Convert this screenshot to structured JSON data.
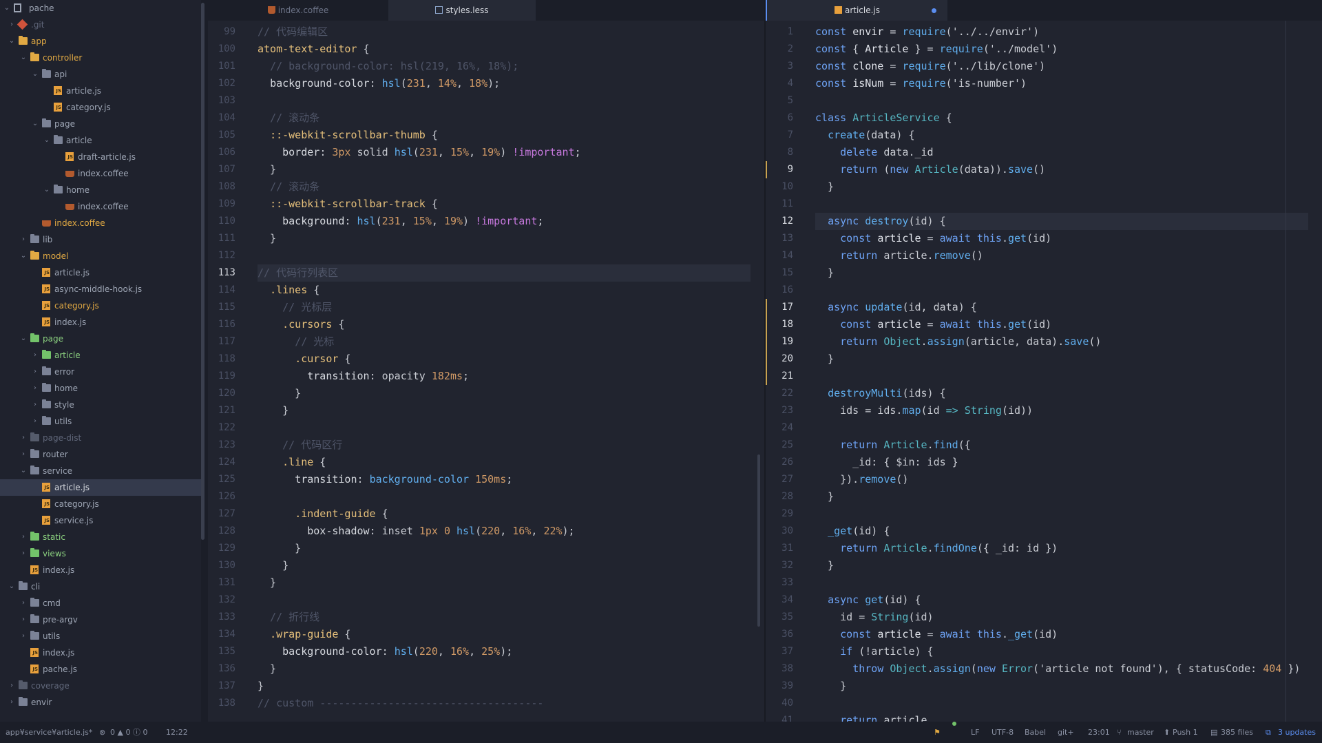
{
  "tree": {
    "root": "pache",
    "items": [
      {
        "label": ".git",
        "depth": 1,
        "kind": "git",
        "chev": "right",
        "color": "dim"
      },
      {
        "label": "app",
        "depth": 1,
        "kind": "folder-yellow",
        "chev": "down",
        "color": "yellow"
      },
      {
        "label": "controller",
        "depth": 2,
        "kind": "folder-yellow",
        "chev": "down",
        "color": "yellow"
      },
      {
        "label": "api",
        "depth": 3,
        "kind": "folder",
        "chev": "down",
        "color": "norm"
      },
      {
        "label": "article.js",
        "depth": 4,
        "kind": "js",
        "chev": "",
        "color": "norm"
      },
      {
        "label": "category.js",
        "depth": 4,
        "kind": "js",
        "chev": "",
        "color": "norm"
      },
      {
        "label": "page",
        "depth": 3,
        "kind": "folder",
        "chev": "down",
        "color": "norm"
      },
      {
        "label": "article",
        "depth": 4,
        "kind": "folder",
        "chev": "down",
        "color": "norm"
      },
      {
        "label": "draft-article.js",
        "depth": 5,
        "kind": "js",
        "chev": "",
        "color": "norm"
      },
      {
        "label": "index.coffee",
        "depth": 5,
        "kind": "coffee",
        "chev": "",
        "color": "norm"
      },
      {
        "label": "home",
        "depth": 4,
        "kind": "folder",
        "chev": "down",
        "color": "norm"
      },
      {
        "label": "index.coffee",
        "depth": 5,
        "kind": "coffee",
        "chev": "",
        "color": "norm"
      },
      {
        "label": "index.coffee",
        "depth": 3,
        "kind": "coffee",
        "chev": "",
        "color": "yellow"
      },
      {
        "label": "lib",
        "depth": 2,
        "kind": "folder",
        "chev": "right",
        "color": "norm"
      },
      {
        "label": "model",
        "depth": 2,
        "kind": "folder-yellow",
        "chev": "down",
        "color": "yellow"
      },
      {
        "label": "article.js",
        "depth": 3,
        "kind": "js",
        "chev": "",
        "color": "norm"
      },
      {
        "label": "async-middle-hook.js",
        "depth": 3,
        "kind": "js",
        "chev": "",
        "color": "norm"
      },
      {
        "label": "category.js",
        "depth": 3,
        "kind": "js",
        "chev": "",
        "color": "yellow"
      },
      {
        "label": "index.js",
        "depth": 3,
        "kind": "js",
        "chev": "",
        "color": "norm"
      },
      {
        "label": "page",
        "depth": 2,
        "kind": "folder-green",
        "chev": "down",
        "color": "green"
      },
      {
        "label": "article",
        "depth": 3,
        "kind": "folder-green",
        "chev": "right",
        "color": "green"
      },
      {
        "label": "error",
        "depth": 3,
        "kind": "folder",
        "chev": "right",
        "color": "norm"
      },
      {
        "label": "home",
        "depth": 3,
        "kind": "folder",
        "chev": "right",
        "color": "norm"
      },
      {
        "label": "style",
        "depth": 3,
        "kind": "folder",
        "chev": "right",
        "color": "norm"
      },
      {
        "label": "utils",
        "depth": 3,
        "kind": "folder",
        "chev": "right",
        "color": "norm"
      },
      {
        "label": "page-dist",
        "depth": 2,
        "kind": "folder-dim",
        "chev": "right",
        "color": "dim"
      },
      {
        "label": "router",
        "depth": 2,
        "kind": "folder",
        "chev": "right",
        "color": "norm"
      },
      {
        "label": "service",
        "depth": 2,
        "kind": "folder",
        "chev": "down",
        "color": "norm"
      },
      {
        "label": "article.js",
        "depth": 3,
        "kind": "js",
        "chev": "",
        "color": "white",
        "selected": true
      },
      {
        "label": "category.js",
        "depth": 3,
        "kind": "js",
        "chev": "",
        "color": "norm"
      },
      {
        "label": "service.js",
        "depth": 3,
        "kind": "js",
        "chev": "",
        "color": "norm"
      },
      {
        "label": "static",
        "depth": 2,
        "kind": "folder-green",
        "chev": "right",
        "color": "green"
      },
      {
        "label": "views",
        "depth": 2,
        "kind": "folder-green",
        "chev": "right",
        "color": "green"
      },
      {
        "label": "index.js",
        "depth": 2,
        "kind": "js",
        "chev": "",
        "color": "norm"
      },
      {
        "label": "cli",
        "depth": 1,
        "kind": "folder",
        "chev": "down",
        "color": "norm"
      },
      {
        "label": "cmd",
        "depth": 2,
        "kind": "folder",
        "chev": "right",
        "color": "norm"
      },
      {
        "label": "pre-argv",
        "depth": 2,
        "kind": "folder",
        "chev": "right",
        "color": "norm"
      },
      {
        "label": "utils",
        "depth": 2,
        "kind": "folder",
        "chev": "right",
        "color": "norm"
      },
      {
        "label": "index.js",
        "depth": 2,
        "kind": "js",
        "chev": "",
        "color": "norm"
      },
      {
        "label": "pache.js",
        "depth": 2,
        "kind": "js",
        "chev": "",
        "color": "norm"
      },
      {
        "label": "coverage",
        "depth": 1,
        "kind": "folder-dim",
        "chev": "right",
        "color": "dim"
      },
      {
        "label": "envir",
        "depth": 1,
        "kind": "folder",
        "chev": "right",
        "color": "norm"
      }
    ]
  },
  "left_pane": {
    "tabs": [
      {
        "label": "index.coffee",
        "icon": "coffee-icon",
        "active": false
      },
      {
        "label": "styles.less",
        "icon": "file-text-icon",
        "active": true
      }
    ],
    "first_line": 99,
    "current_line": 113,
    "lines": [
      "<span class=\"cm\">// 代码编辑区</span>",
      "<span class=\"sel\">atom-text-editor</span> {",
      "  <span class=\"cm\">// background-color: hsl(219, 16%, 18%);</span>",
      "  <span class=\"pr\">background-color</span>: <span class=\"fn\">hsl</span>(<span class=\"n\">231</span>, <span class=\"n\">14%</span>, <span class=\"n\">18%</span>);",
      "",
      "  <span class=\"cm\">// 滚动条</span>",
      "  <span class=\"sel\">::-webkit-scrollbar-thumb</span> {",
      "    <span class=\"pr\">border</span>: <span class=\"n\">3px</span> solid <span class=\"fn\">hsl</span>(<span class=\"n\">231</span>, <span class=\"n\">15%</span>, <span class=\"n\">19%</span>) <span class=\"imp\">!important</span>;",
      "  }",
      "  <span class=\"cm\">// 滚动条</span>",
      "  <span class=\"sel\">::-webkit-scrollbar-track</span> {",
      "    <span class=\"pr\">background</span>: <span class=\"fn\">hsl</span>(<span class=\"n\">231</span>, <span class=\"n\">15%</span>, <span class=\"n\">19%</span>) <span class=\"imp\">!important</span>;",
      "  }",
      "",
      "<span class=\"cm\">// 代码行列表区</span>",
      "  <span class=\"sel\">.lines</span> {",
      "    <span class=\"cm\">// 光标层</span>",
      "    <span class=\"sel\">.cursors</span> {",
      "      <span class=\"cm\">// 光标</span>",
      "      <span class=\"sel\">.cursor</span> {",
      "        <span class=\"pr\">transition</span>: opacity <span class=\"n\">182ms</span>;",
      "      }",
      "    }",
      "",
      "    <span class=\"cm\">// 代码区行</span>",
      "    <span class=\"sel\">.line</span> {",
      "      <span class=\"pr\">transition</span>: <span class=\"fn\">background-color</span> <span class=\"n\">150ms</span>;",
      "",
      "      <span class=\"sel\">.indent-guide</span> {",
      "        <span class=\"pr\">box-shadow</span>: inset <span class=\"n\">1px</span> <span class=\"n\">0</span> <span class=\"fn\">hsl</span>(<span class=\"n\">220</span>, <span class=\"n\">16%</span>, <span class=\"n\">22%</span>);",
      "      }",
      "    }",
      "  }",
      "",
      "  <span class=\"cm\">// 折行线</span>",
      "  <span class=\"sel\">.wrap-guide</span> {",
      "    <span class=\"pr\">background-color</span>: <span class=\"fn\">hsl</span>(<span class=\"n\">220</span>, <span class=\"n\">16%</span>, <span class=\"n\">25%</span>);",
      "  }",
      "}",
      "<span class=\"cm\">// custom ------------------------------------</span>"
    ]
  },
  "right_pane": {
    "tabs": [
      {
        "label": "article.js",
        "icon": "js-file-icon",
        "active": true,
        "modified": true
      }
    ],
    "first_line": 1,
    "current_line": 12,
    "marked_lines": [
      9,
      17,
      18,
      19,
      20,
      21
    ],
    "lines": [
      "<span class=\"kw\">const</span> <span class=\"v\">envir</span> = <span class=\"fn\">require</span>(<span class=\"str\">'../../envir'</span>)",
      "<span class=\"kw\">const</span> { <span class=\"v\">Article</span> } = <span class=\"fn\">require</span>(<span class=\"str\">'../model'</span>)",
      "<span class=\"kw\">const</span> <span class=\"v\">clone</span> = <span class=\"fn\">require</span>(<span class=\"str\">'../lib/clone'</span>)",
      "<span class=\"kw\">const</span> <span class=\"v\">isNum</span> = <span class=\"fn\">require</span>(<span class=\"str\">'is-number'</span>)",
      "",
      "<span class=\"kw\">class</span> <span class=\"cls\">ArticleService</span> {",
      "  <span class=\"fn\">create</span>(data) {",
      "    <span class=\"kw\">delete</span> data._id",
      "    <span class=\"kw\">return</span> (<span class=\"kw\">new</span> <span class=\"cls\">Article</span>(data)).<span class=\"fn\">save</span>()",
      "  }",
      "",
      "  <span class=\"kw\">async</span> <span class=\"fn\">destroy</span>(id) {",
      "    <span class=\"kw\">const</span> <span class=\"v\">article</span> = <span class=\"kw\">await</span> <span class=\"kw\">this</span>.<span class=\"fn\">get</span>(id)",
      "    <span class=\"kw\">return</span> article.<span class=\"fn\">remove</span>()",
      "  }",
      "",
      "  <span class=\"kw\">async</span> <span class=\"fn\">update</span>(id, data) {",
      "    <span class=\"kw\">const</span> <span class=\"v\">article</span> = <span class=\"kw\">await</span> <span class=\"kw\">this</span>.<span class=\"fn\">get</span>(id)",
      "    <span class=\"kw\">return</span> <span class=\"cls\">Object</span>.<span class=\"fn\">assign</span>(article, data).<span class=\"fn\">save</span>()",
      "  }",
      "",
      "  <span class=\"fn\">destroyMulti</span>(ids) {",
      "    ids = ids.<span class=\"fn\">map</span>(id <span class=\"op\">=&gt;</span> <span class=\"cls\">String</span>(id))",
      "",
      "    <span class=\"kw\">return</span> <span class=\"cls\">Article</span>.<span class=\"fn\">find</span>({",
      "      _id: { $in: ids }",
      "    }).<span class=\"fn\">remove</span>()",
      "  }",
      "",
      "  <span class=\"fn\">_get</span>(id) {",
      "    <span class=\"kw\">return</span> <span class=\"cls\">Article</span>.<span class=\"fn\">findOne</span>({ _id: id })",
      "  }",
      "",
      "  <span class=\"kw\">async</span> <span class=\"fn\">get</span>(id) {",
      "    id = <span class=\"cls\">String</span>(id)",
      "    <span class=\"kw\">const</span> <span class=\"v\">article</span> = <span class=\"kw\">await</span> <span class=\"kw\">this</span>.<span class=\"fn\">_get</span>(id)",
      "    <span class=\"kw\">if</span> (!article) {",
      "      <span class=\"kw\">throw</span> <span class=\"cls\">Object</span>.<span class=\"fn\">assign</span>(<span class=\"kw\">new</span> <span class=\"cls\">Error</span>(<span class=\"str\">'article not found'</span>), { statusCode: <span class=\"n\">404</span> })",
      "    }",
      "",
      "    <span class=\"kw\">return</span> article"
    ]
  },
  "status": {
    "path": "app¥service¥article.js*",
    "diagnostics": "0 ▲ 0 ⓘ 0",
    "cursor_left": "12:22",
    "line_ending": "LF",
    "encoding": "UTF-8",
    "grammar": "Babel",
    "git": "git+",
    "cursor_right": "23:01",
    "branch": "master",
    "push": "Push 1",
    "files": "385 files",
    "updates": "3 updates"
  },
  "colors": {
    "accent": "#5b8ef0",
    "git_modified": "#c8a250",
    "bg": "#21242f"
  }
}
